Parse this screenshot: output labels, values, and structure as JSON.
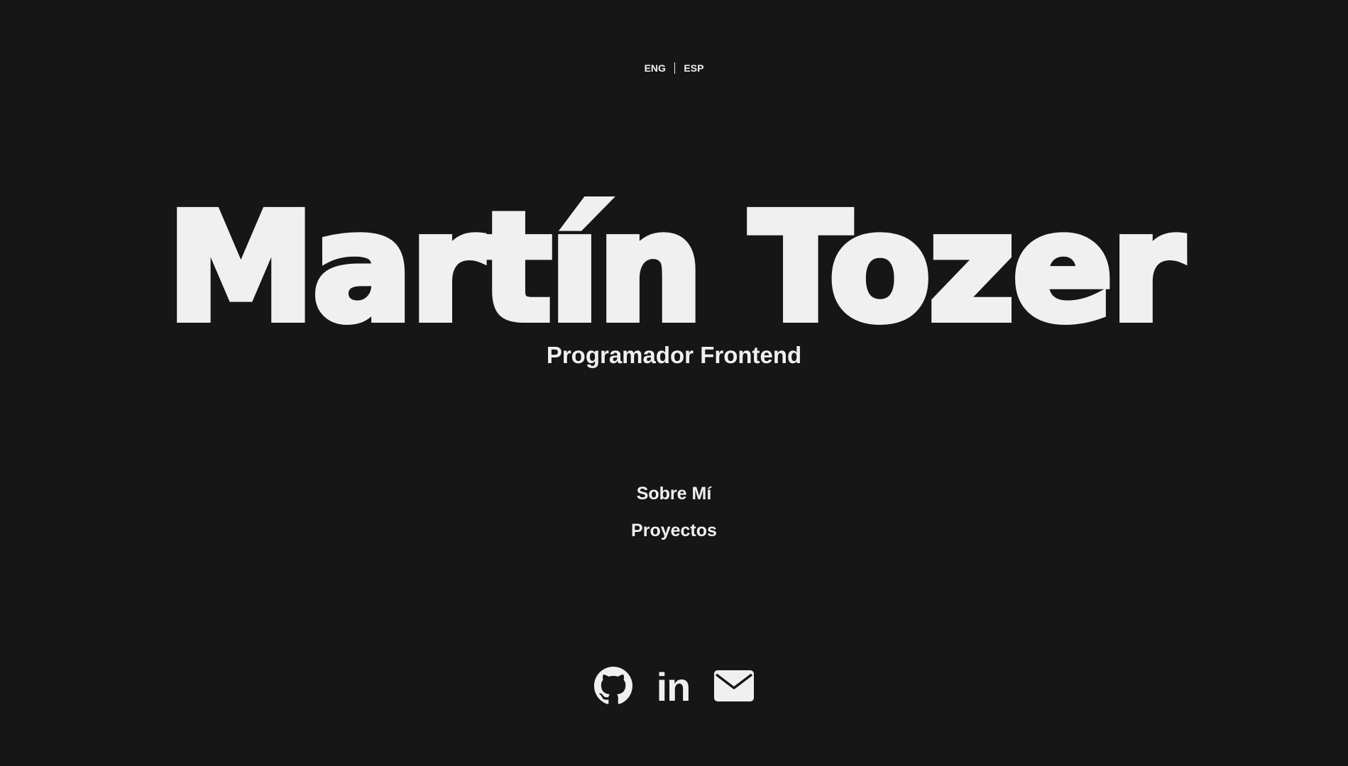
{
  "language_switch": {
    "options": [
      "ENG",
      "ESP"
    ]
  },
  "hero": {
    "name": "Martín Tozer",
    "subtitle": "Programador Frontend"
  },
  "nav": {
    "items": [
      {
        "label": "Sobre Mí"
      },
      {
        "label": "Proyectos"
      }
    ]
  },
  "socials": {
    "icons": [
      "github-icon",
      "linkedin-icon",
      "email-icon"
    ],
    "linkedin_glyph": "in"
  },
  "colors": {
    "background": "#161616",
    "foreground": "#f0f0f0"
  }
}
